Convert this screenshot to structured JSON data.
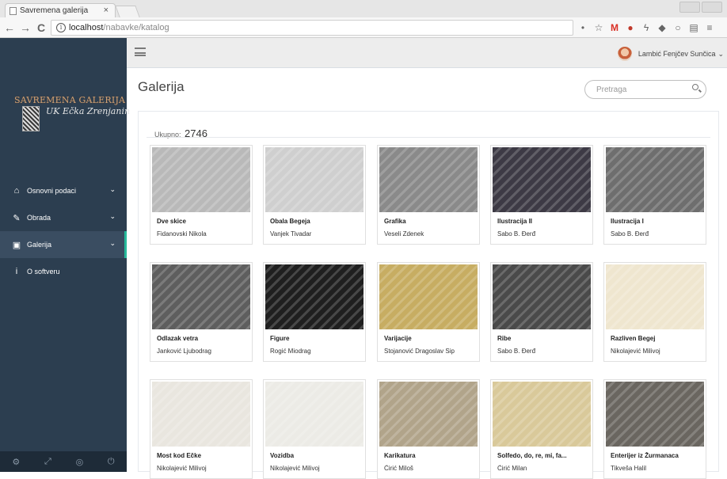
{
  "browser": {
    "tab_title": "Savremena galerija",
    "tab_close": "×",
    "url_host": "localhost",
    "url_path": "/nabavke/katalog",
    "back_glyph": "←",
    "forward_glyph": "→",
    "reload_glyph": "C",
    "info_glyph": "i",
    "ext_icons": [
      "pin-icon",
      "star-icon",
      "gmail-icon",
      "ublock-icon",
      "bolt-icon",
      "puzzle-icon",
      "circle-icon",
      "pdf-icon",
      "menu-icon"
    ]
  },
  "sidebar": {
    "logo_title": "SAVREMENA GALERIJA",
    "logo_subtitle": "UK Ečka Zrenjanin",
    "items": [
      {
        "label": "Osnovni podaci",
        "icon": "home-icon",
        "glyph": "⌂",
        "has_chevron": true,
        "active": false
      },
      {
        "label": "Obrada",
        "icon": "edit-icon",
        "glyph": "✎",
        "has_chevron": true,
        "active": false
      },
      {
        "label": "Galerija",
        "icon": "picture-icon",
        "glyph": "▣",
        "has_chevron": true,
        "active": true
      },
      {
        "label": "O softveru",
        "icon": "info-icon",
        "glyph": "i",
        "has_chevron": false,
        "active": false
      }
    ],
    "chevron": "⌄",
    "footer": [
      {
        "name": "settings-icon",
        "glyph": "⚙"
      },
      {
        "name": "fullscreen-icon",
        "glyph": "⤢"
      },
      {
        "name": "eye-slash-icon",
        "glyph": "◎"
      },
      {
        "name": "power-icon",
        "glyph": "⏻"
      }
    ]
  },
  "topnav": {
    "user_name": "Lambić Fenjčev Sunčica",
    "user_caret": "⌄"
  },
  "main": {
    "title": "Galerija",
    "search_placeholder": "Pretraga",
    "total_label": "Ukupno:",
    "total_value": "2746"
  },
  "gallery": [
    {
      "title": "Dve skice",
      "artist": "Fidanovski Nikola",
      "tone": "#b9b9b9"
    },
    {
      "title": "Obala Begeja",
      "artist": "Vanjek Tivadar",
      "tone": "#cfcfcf"
    },
    {
      "title": "Grafika",
      "artist": "Veseli Zdenek",
      "tone": "#8a8a8a"
    },
    {
      "title": "Ilustracija II",
      "artist": "Sabo B. Đerđ",
      "tone": "#3d3a45"
    },
    {
      "title": "Ilustracija I",
      "artist": "Sabo B. Đerđ",
      "tone": "#6e6e6e"
    },
    {
      "title": "Odlazak vetra",
      "artist": "Janković Ljubodrag",
      "tone": "#5e5e5e"
    },
    {
      "title": "Figure",
      "artist": "Rogić Miodrag",
      "tone": "#1f1f1f"
    },
    {
      "title": "Varijacije",
      "artist": "Stojanović Dragoslav Sip",
      "tone": "#c7ad62"
    },
    {
      "title": "Ribe",
      "artist": "Sabo B. Đerđ",
      "tone": "#4a4a4a"
    },
    {
      "title": "Razliven Begej",
      "artist": "Nikolajević Milivoj",
      "tone": "#efe6cf"
    },
    {
      "title": "Most kod Ečke",
      "artist": "Nikolajević Milivoj",
      "tone": "#e9e6df"
    },
    {
      "title": "Vozidba",
      "artist": "Nikolajević Milivoj",
      "tone": "#ecebe6"
    },
    {
      "title": "Karikatura",
      "artist": "Ćirić Miloš",
      "tone": "#b1a48a"
    },
    {
      "title": "Solfedo, do, re, mi, fa...",
      "artist": "Ćirić Milan",
      "tone": "#d9c99a"
    },
    {
      "title": "Enterijer iz Žurmanaca",
      "artist": "Tikveša Halil",
      "tone": "#6a6660"
    }
  ]
}
